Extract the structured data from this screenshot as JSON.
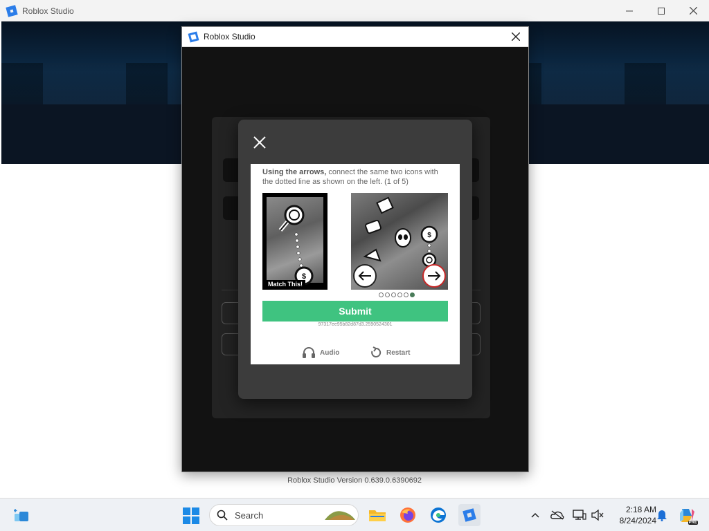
{
  "app": {
    "title": "Roblox Studio",
    "version": "Roblox Studio Version 0.639.0.6390692"
  },
  "studio_dialog": {
    "title": "Roblox Studio"
  },
  "captcha": {
    "instruction_bold": "Using the arrows,",
    "instruction_rest": " connect the same two icons with the dotted line as shown on the left. (1 of 5)",
    "match_label": "Match This!",
    "submit_label": "Submit",
    "session_id": "97317ee95b82d87d3.2590524301",
    "audio_label": "Audio",
    "restart_label": "Restart",
    "progress": {
      "current": 6,
      "total": 6
    }
  },
  "taskbar": {
    "search_placeholder": "Search",
    "time": "2:18 AM",
    "date": "8/24/2024",
    "copilot_badge": "PRE"
  },
  "colors": {
    "accent": "#2b7de9",
    "submit": "#3fc380",
    "modal_bg": "#3c3c3c",
    "dialog_bg": "#121212"
  }
}
